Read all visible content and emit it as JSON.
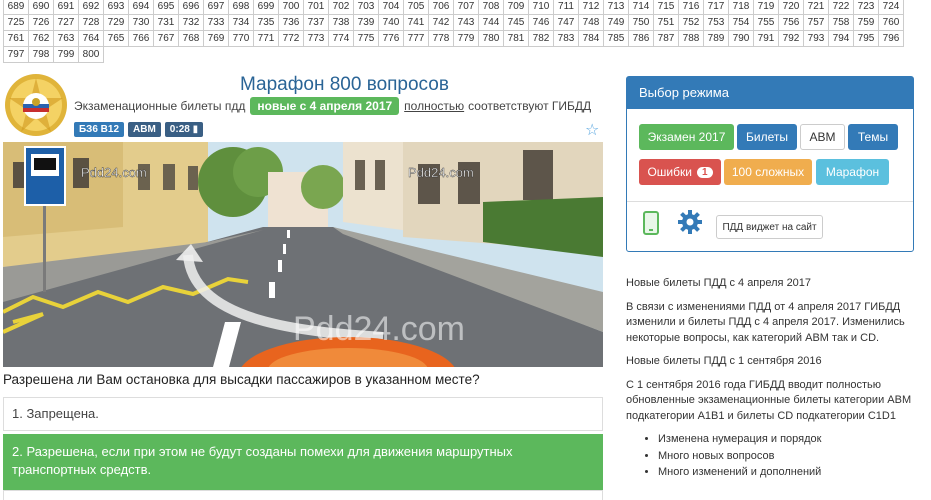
{
  "question_numbers": [
    "689",
    "690",
    "691",
    "692",
    "693",
    "694",
    "695",
    "696",
    "697",
    "698",
    "699",
    "700",
    "701",
    "702",
    "703",
    "704",
    "705",
    "706",
    "707",
    "708",
    "709",
    "710",
    "711",
    "712",
    "713",
    "714",
    "715",
    "716",
    "717",
    "718",
    "719",
    "720",
    "721",
    "722",
    "723",
    "724",
    "725",
    "726",
    "727",
    "728",
    "729",
    "730",
    "731",
    "732",
    "733",
    "734",
    "735",
    "736",
    "737",
    "738",
    "739",
    "740",
    "741",
    "742",
    "743",
    "744",
    "745",
    "746",
    "747",
    "748",
    "749",
    "750",
    "751",
    "752",
    "753",
    "754",
    "755",
    "756",
    "757",
    "758",
    "759",
    "760",
    "761",
    "762",
    "763",
    "764",
    "765",
    "766",
    "767",
    "768",
    "769",
    "770",
    "771",
    "772",
    "773",
    "774",
    "775",
    "776",
    "777",
    "778",
    "779",
    "780",
    "781",
    "782",
    "783",
    "784",
    "785",
    "786",
    "787",
    "788",
    "789",
    "790",
    "791",
    "792",
    "793",
    "794",
    "795",
    "796",
    "797",
    "798",
    "799",
    "800"
  ],
  "header": {
    "title": "Марафон 800 вопросов",
    "subtitle_pre": "Экзаменационные билеты пдд",
    "badge_new": "новые с 4 апреля 2017",
    "link_word": "полностью",
    "subtitle_post": "соответствуют ГИБДД"
  },
  "tags": [
    "БЗ6 В12",
    "АВМ",
    "0:28 ▮"
  ],
  "image": {
    "watermark_small": "Pdd24.com",
    "watermark_large": "Pdd24.com"
  },
  "question": "Разрешена ли Вам остановка для высадки пассажиров в указанном месте?",
  "answers": [
    "1. Запрещена.",
    "2. Разрешена, если при этом не будут созданы помехи для движения маршрутных транспортных средств."
  ],
  "panel": {
    "title": "Выбор режима",
    "exam": "Экзамен 2017",
    "tickets": "Билеты",
    "abm": "АВМ",
    "topics": "Темы",
    "errors": "Ошибки",
    "errors_count": "1",
    "hard": "100 сложных",
    "marathon": "Марафон",
    "widget": "ПДД виджет на сайт"
  },
  "news": {
    "p1": "Новые билеты ПДД с 4 апреля 2017",
    "p2": "В связи с изменениями ПДД от 4 апреля 2017 ГИБДД изменили и билеты ПДД с 4 апреля 2017. Изменились некоторые вопросы, как категорий АВМ так и CD.",
    "p3": "Новые билеты ПДД с 1 сентября 2016",
    "p4": "С 1 сентября 2016 года ГИБДД вводит полностью обновленные экзаменационные билеты категории АВМ подкатегории A1B1 и билеты CD подкатегории C1D1",
    "bullets": [
      "Изменена нумерация и порядок",
      "Много новых вопросов",
      "Много изменений и дополнений"
    ]
  },
  "colors": {
    "primary": "#337ab7",
    "success": "#5cb85c",
    "danger": "#d9534f",
    "warning": "#f0ad4e",
    "info": "#5bc0de"
  }
}
